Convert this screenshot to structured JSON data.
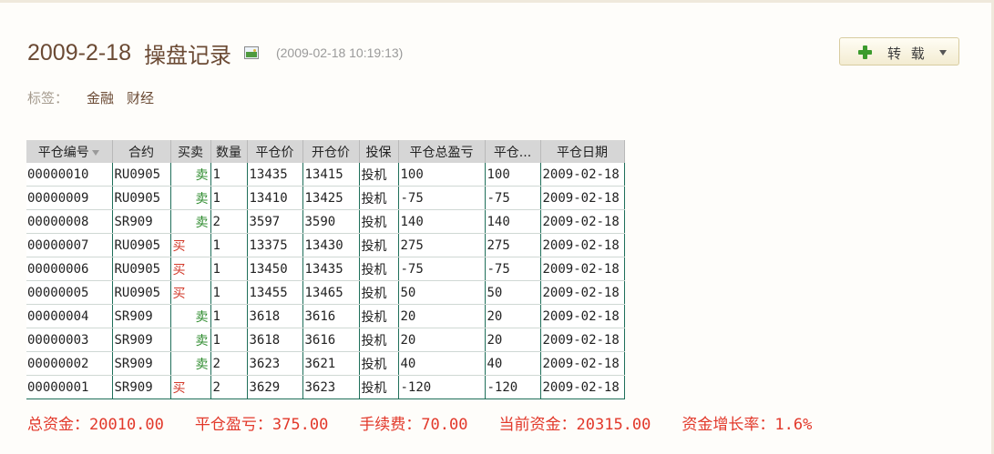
{
  "post": {
    "title_date": "2009-2-18",
    "title_text": "操盘记录",
    "timestamp": "(2009-02-18 10:19:13)",
    "repost_label": "转 载",
    "tags_label": "标签：",
    "tags": [
      "金融",
      "财经"
    ]
  },
  "table": {
    "columns": [
      "平仓编号",
      "合约",
      "买卖",
      "数量",
      "平仓价",
      "开仓价",
      "投保",
      "平仓总盈亏",
      "平仓...",
      "平仓日期"
    ],
    "rows": [
      {
        "id": "00000010",
        "contract": "RU0905",
        "side": "卖",
        "side_type": "sell",
        "qty": "1",
        "close_price": "13435",
        "open_price": "13415",
        "hedge": "投机",
        "total_pl": "100",
        "pl": "100",
        "date": "2009-02-18"
      },
      {
        "id": "00000009",
        "contract": "RU0905",
        "side": "卖",
        "side_type": "sell",
        "qty": "1",
        "close_price": "13410",
        "open_price": "13425",
        "hedge": "投机",
        "total_pl": "-75",
        "pl": "-75",
        "date": "2009-02-18"
      },
      {
        "id": "00000008",
        "contract": "SR909",
        "side": "卖",
        "side_type": "sell",
        "qty": "2",
        "close_price": "3597",
        "open_price": "3590",
        "hedge": "投机",
        "total_pl": "140",
        "pl": "140",
        "date": "2009-02-18"
      },
      {
        "id": "00000007",
        "contract": "RU0905",
        "side": "买",
        "side_type": "buy",
        "qty": "1",
        "close_price": "13375",
        "open_price": "13430",
        "hedge": "投机",
        "total_pl": "275",
        "pl": "275",
        "date": "2009-02-18"
      },
      {
        "id": "00000006",
        "contract": "RU0905",
        "side": "买",
        "side_type": "buy",
        "qty": "1",
        "close_price": "13450",
        "open_price": "13435",
        "hedge": "投机",
        "total_pl": "-75",
        "pl": "-75",
        "date": "2009-02-18"
      },
      {
        "id": "00000005",
        "contract": "RU0905",
        "side": "买",
        "side_type": "buy",
        "qty": "1",
        "close_price": "13455",
        "open_price": "13465",
        "hedge": "投机",
        "total_pl": "50",
        "pl": "50",
        "date": "2009-02-18"
      },
      {
        "id": "00000004",
        "contract": "SR909",
        "side": "卖",
        "side_type": "sell",
        "qty": "1",
        "close_price": "3618",
        "open_price": "3616",
        "hedge": "投机",
        "total_pl": "20",
        "pl": "20",
        "date": "2009-02-18"
      },
      {
        "id": "00000003",
        "contract": "SR909",
        "side": "卖",
        "side_type": "sell",
        "qty": "1",
        "close_price": "3618",
        "open_price": "3616",
        "hedge": "投机",
        "total_pl": "20",
        "pl": "20",
        "date": "2009-02-18"
      },
      {
        "id": "00000002",
        "contract": "SR909",
        "side": "卖",
        "side_type": "sell",
        "qty": "2",
        "close_price": "3623",
        "open_price": "3621",
        "hedge": "投机",
        "total_pl": "40",
        "pl": "40",
        "date": "2009-02-18"
      },
      {
        "id": "00000001",
        "contract": "SR909",
        "side": "买",
        "side_type": "buy",
        "qty": "2",
        "close_price": "3629",
        "open_price": "3623",
        "hedge": "投机",
        "total_pl": "-120",
        "pl": "-120",
        "date": "2009-02-18"
      }
    ]
  },
  "summary": {
    "total_funds": "总资金：20010.00",
    "close_pl": "平仓盈亏：375.00",
    "fee": "手续费：70.00",
    "current_funds": "当前资金：20315.00",
    "growth": "资金增长率：1.6%"
  },
  "colors": {
    "title": "#6b4a34",
    "sell": "#2e8b2e",
    "buy": "#d23a2a",
    "summary": "#e2382a",
    "plus_icon": "#3c9b2d"
  },
  "icons": [
    "image-icon",
    "plus-icon",
    "caret-down-icon",
    "sort-icon"
  ]
}
